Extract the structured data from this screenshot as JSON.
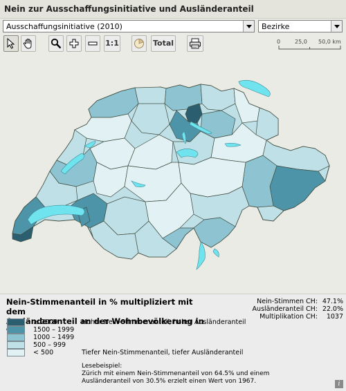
{
  "title": "Nein zur Ausschaffungsinitiative und Ausländeranteil",
  "vote_select": {
    "value": "Ausschaffungsinitiative (2010)"
  },
  "level_select": {
    "value": "Bezirke"
  },
  "toolbar": {
    "tools": [
      {
        "name": "pointer-tool",
        "icon": "pointer-icon",
        "active": true
      },
      {
        "name": "pan-tool",
        "icon": "hand-icon"
      },
      {
        "name": "zoom-tool",
        "icon": "magnifier-icon"
      },
      {
        "name": "zoom-in-tool",
        "icon": "plus-icon"
      },
      {
        "name": "zoom-out-tool",
        "icon": "minus-icon"
      },
      {
        "name": "one-to-one-tool",
        "label": "1:1"
      },
      {
        "name": "chart-tool",
        "icon": "pie-chart-icon"
      },
      {
        "name": "total-button",
        "label": "Total"
      },
      {
        "name": "print-button",
        "icon": "printer-icon"
      }
    ],
    "one_to_one_label": "1:1",
    "total_label": "Total"
  },
  "scale_bar": {
    "ticks": [
      "0",
      "25,0",
      "50,0 km"
    ]
  },
  "colors": {
    "water": "#6fe3ee",
    "class_5": "#2b5e6e",
    "class_4": "#4e94a8",
    "class_3": "#8ec4d2",
    "class_2": "#bfe0e6",
    "class_1": "#e2f2f4"
  },
  "legend": {
    "title_line1": "Nein-Stimmenanteil in % multipliziert mit dem",
    "title_line2": "Ausländeranteil an der Wohnbevölkerung in %",
    "stats": [
      {
        "label": "Nein-Stimmen CH:",
        "value": "47.1%"
      },
      {
        "label": "Ausländeranteil CH:",
        "value": "22.0%"
      },
      {
        "label": "Multiplikation CH:",
        "value": "1037"
      }
    ],
    "classes": [
      {
        "range": "≥  2000",
        "color": "#2b5e6e"
      },
      {
        "range": "1500 – 1999",
        "color": "#4e94a8"
      },
      {
        "range": "1000 – 1499",
        "color": "#8ec4d2"
      },
      {
        "range": "500 –   999",
        "color": "#bfe0e6"
      },
      {
        "range": "<   500",
        "color": "#e2f2f4"
      }
    ],
    "high_label": "Hoher Nein-Stimmenanteil, hoher Ausländeranteil",
    "low_label": "Tiefer Nein-Stimmenanteil, tiefer Ausländeranteil",
    "lesebeispiel_title": "Lesebeispiel:",
    "lesebeispiel_line1": "Zürich mit einem Nein-Stimmenanteil von 64.5% und einem",
    "lesebeispiel_line2": "Ausländeranteil von 30.5% erzielt einen Wert von 1967.",
    "info_label": "i"
  }
}
